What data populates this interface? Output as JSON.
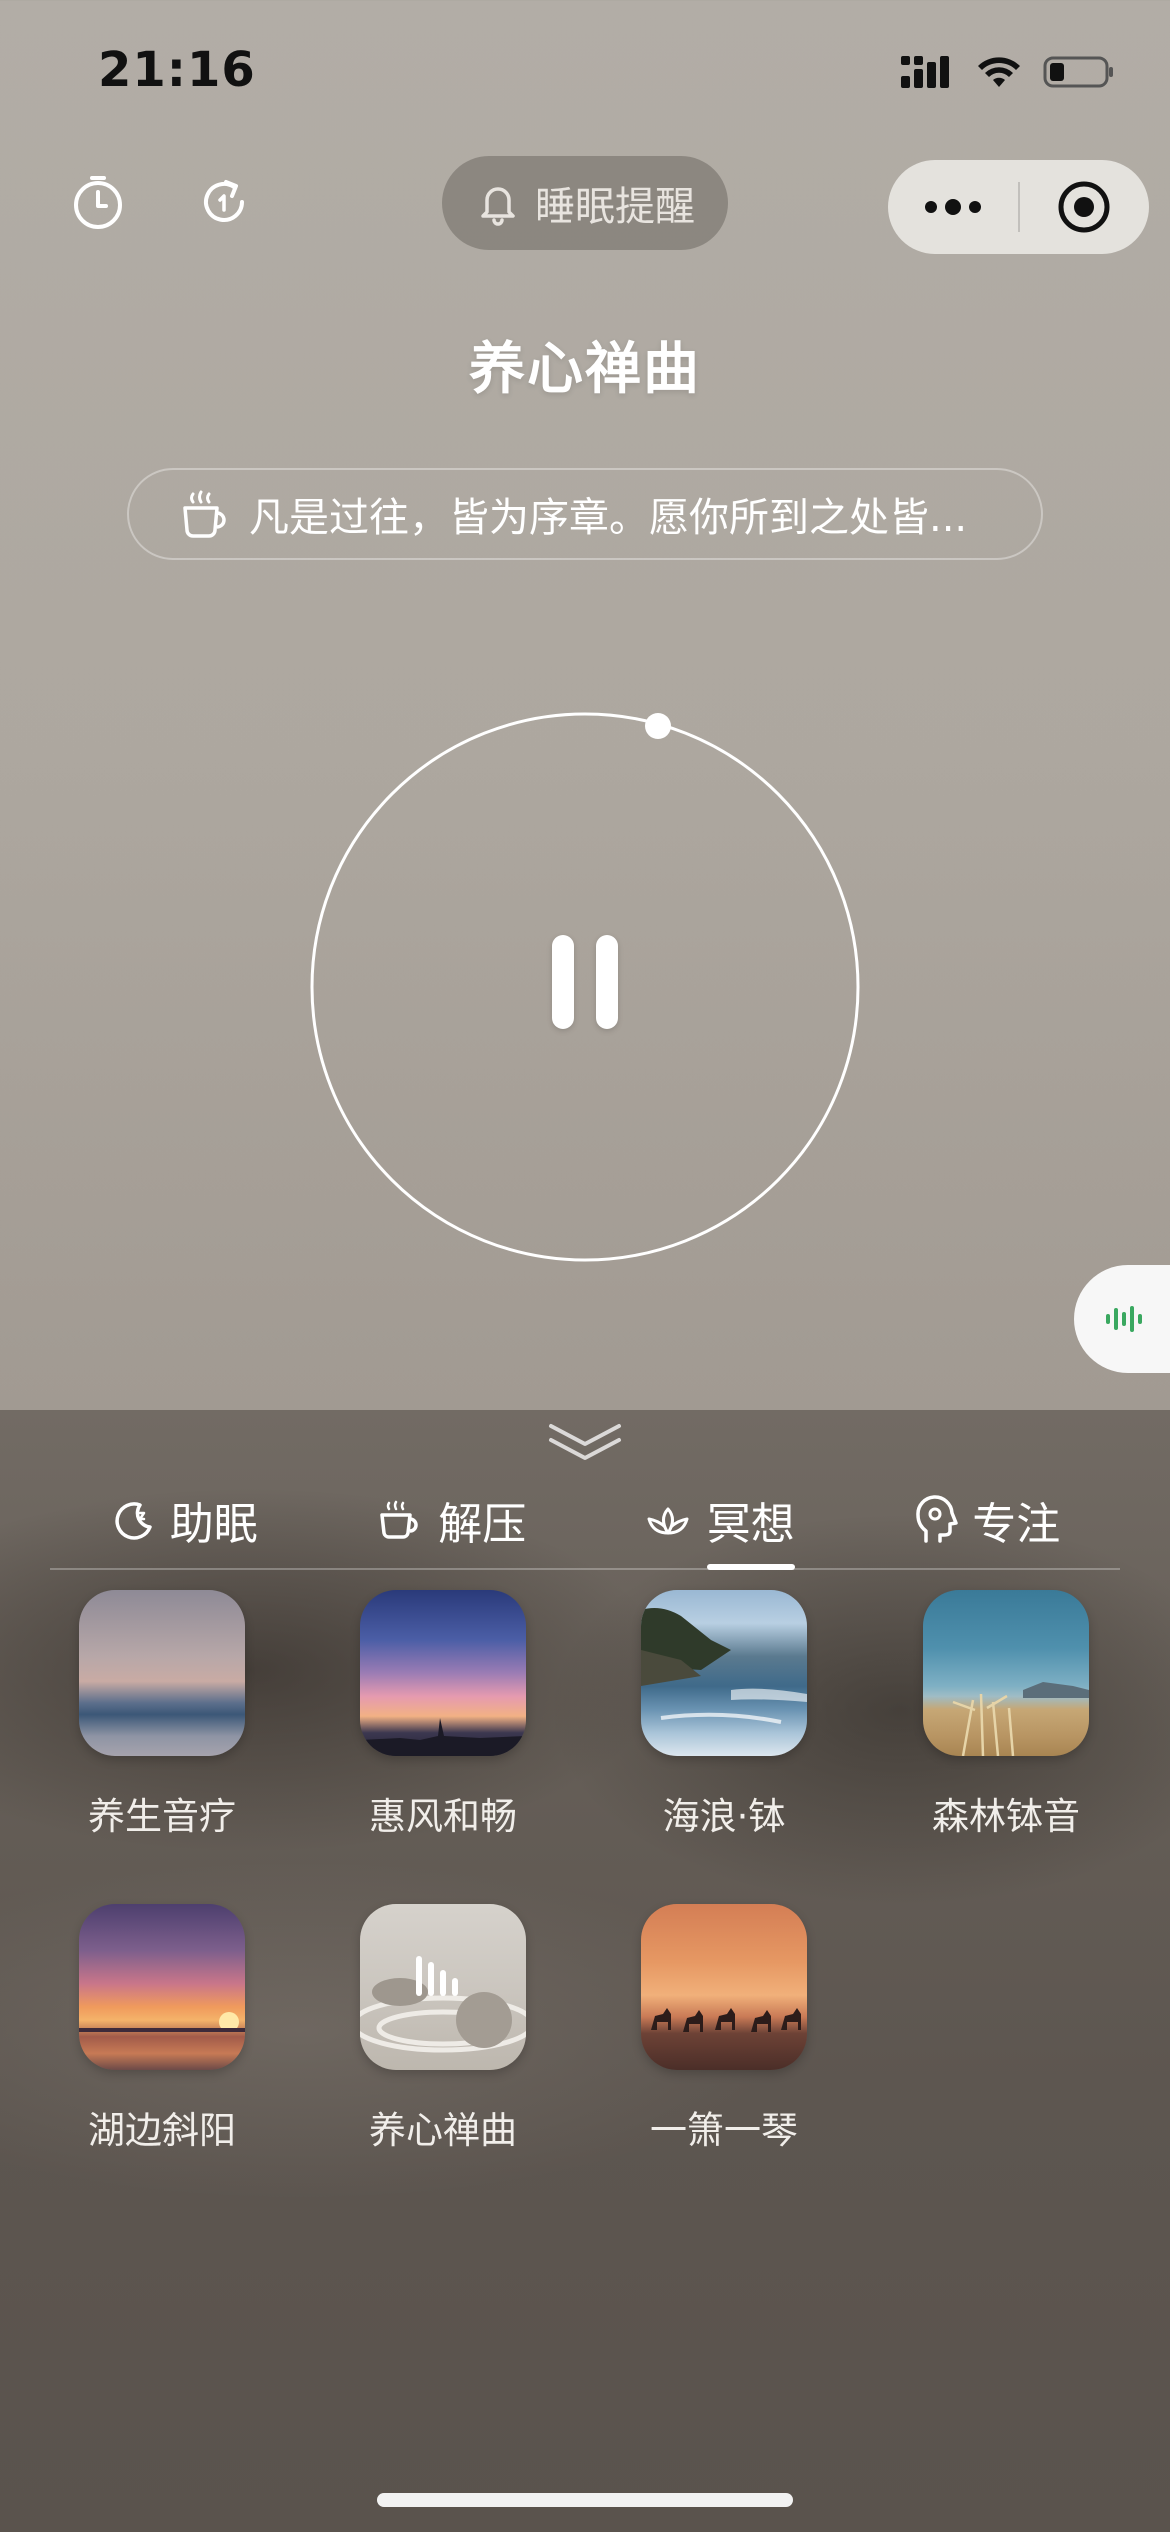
{
  "status": {
    "time": "21:16"
  },
  "header": {
    "reminder_label": "睡眠提醒"
  },
  "player": {
    "title": "养心禅曲",
    "quote": "凡是过往，皆为序章。愿你所到之处皆..."
  },
  "tabs": [
    {
      "label": "助眠",
      "icon": "moon-icon",
      "active": false
    },
    {
      "label": "解压",
      "icon": "coffee-cup-icon",
      "active": false
    },
    {
      "label": "冥想",
      "icon": "lotus-icon",
      "active": true
    },
    {
      "label": "专注",
      "icon": "head-icon",
      "active": false
    }
  ],
  "tracks": [
    {
      "label": "养生音疗",
      "thumb": "hazy-horizon"
    },
    {
      "label": "惠风和畅",
      "thumb": "sunset-city"
    },
    {
      "label": "海浪·钵",
      "thumb": "coast-waves"
    },
    {
      "label": "森林钵音",
      "thumb": "beach-grass"
    },
    {
      "label": "湖边斜阳",
      "thumb": "lake-sunset"
    },
    {
      "label": "养心禅曲",
      "thumb": "zen-stones"
    },
    {
      "label": "一箫一琴",
      "thumb": "desert-camels"
    }
  ],
  "colors": {
    "accent_green": "#3aa860",
    "panel_bg": "#5e5751"
  }
}
